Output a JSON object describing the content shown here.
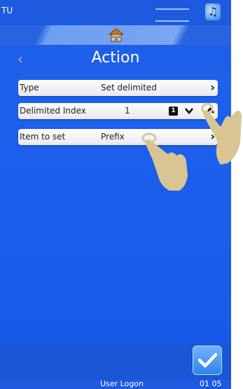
{
  "status": {
    "text": "TU"
  },
  "header": {
    "title": "Action",
    "back_icon": "chevron-left-icon",
    "home_icon": "home-icon"
  },
  "rows": [
    {
      "label": "Type",
      "value": "Set delimited",
      "action_icon": "chevron-right-icon"
    },
    {
      "label": "Delimited Index",
      "value": "1",
      "badge": "1",
      "controls": [
        "chevron-down-icon",
        "chevron-up-icon"
      ]
    },
    {
      "label": "Item to set",
      "value": "Prefix",
      "action_icon": "chevron-right-icon"
    }
  ],
  "footer": {
    "user": "User Logon",
    "time": "01 05"
  },
  "colors": {
    "background": "#1559e8",
    "accent": "#2f85e8"
  }
}
